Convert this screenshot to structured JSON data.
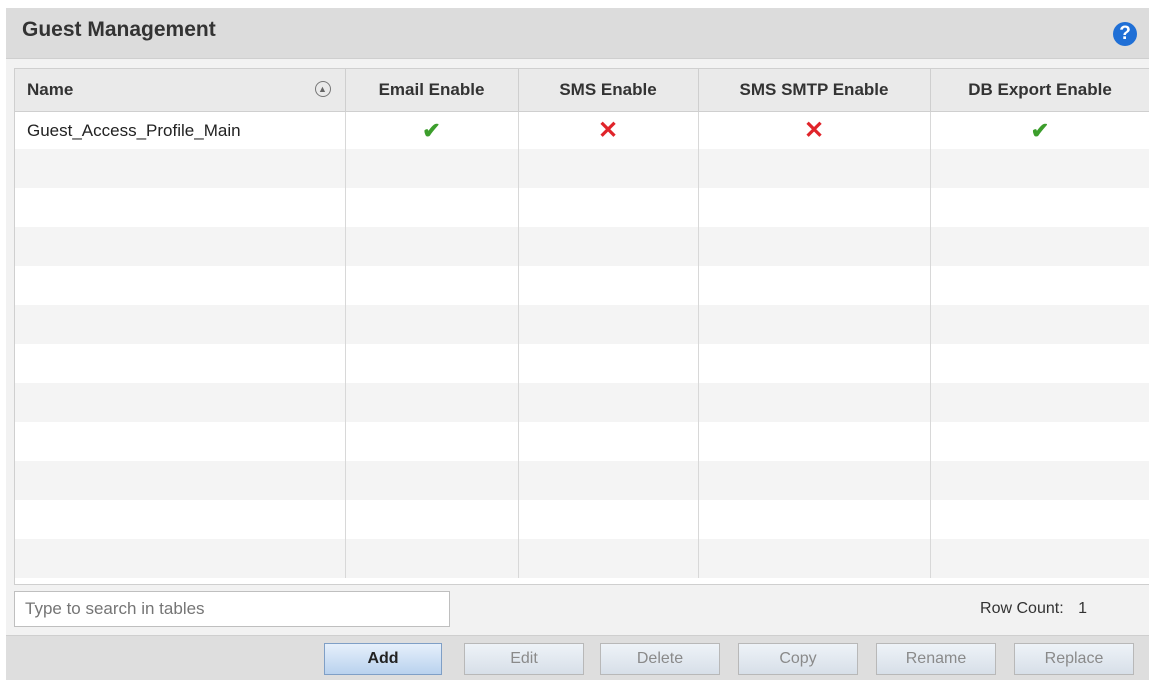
{
  "header": {
    "title": "Guest Management",
    "help_label": "?"
  },
  "table": {
    "columns": [
      "Name",
      "Email Enable",
      "SMS Enable",
      "SMS SMTP Enable",
      "DB Export Enable"
    ],
    "rows": [
      {
        "name": "Guest_Access_Profile_Main",
        "email_enable": true,
        "sms_enable": false,
        "sms_smtp_enable": false,
        "db_export_enable": true
      }
    ]
  },
  "search": {
    "placeholder": "Type to search in tables",
    "value": ""
  },
  "row_count": {
    "label": "Row Count:",
    "value": "1"
  },
  "buttons": {
    "add": "Add",
    "edit": "Edit",
    "delete": "Delete",
    "copy": "Copy",
    "rename": "Rename",
    "replace": "Replace"
  },
  "colors": {
    "check": "#3c9e2c",
    "cross": "#e0242a",
    "help": "#1f6fd6"
  }
}
